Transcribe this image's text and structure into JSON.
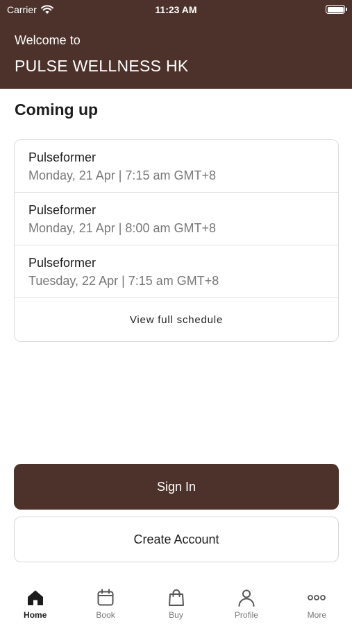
{
  "status_bar": {
    "carrier": "Carrier",
    "time": "11:23 AM"
  },
  "header": {
    "welcome": "Welcome to",
    "brand": "PULSE WELLNESS HK",
    "color": "#4c322b"
  },
  "coming_up": {
    "title": "Coming up",
    "items": [
      {
        "name": "Pulseformer",
        "datetime": "Monday, 21 Apr | 7:15 am GMT+8"
      },
      {
        "name": "Pulseformer",
        "datetime": "Monday, 21 Apr | 8:00 am GMT+8"
      },
      {
        "name": "Pulseformer",
        "datetime": "Tuesday, 22 Apr | 7:15 am GMT+8"
      }
    ],
    "view_all_label": "View full schedule"
  },
  "actions": {
    "sign_in_label": "Sign In",
    "create_account_label": "Create Account"
  },
  "tabbar": {
    "tabs": [
      {
        "label": "Home",
        "icon": "home-icon",
        "active": true
      },
      {
        "label": "Book",
        "icon": "calendar-icon",
        "active": false
      },
      {
        "label": "Buy",
        "icon": "bag-icon",
        "active": false
      },
      {
        "label": "Profile",
        "icon": "person-icon",
        "active": false
      },
      {
        "label": "More",
        "icon": "more-icon",
        "active": false
      }
    ]
  }
}
